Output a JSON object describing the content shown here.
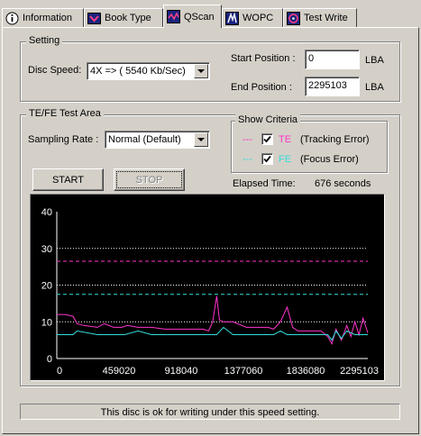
{
  "tabs": [
    {
      "label": "Information",
      "icon": "info-icon"
    },
    {
      "label": "Book Type",
      "icon": "book-type-icon"
    },
    {
      "label": "QScan",
      "icon": "qscan-icon"
    },
    {
      "label": "WOPC",
      "icon": "wopc-icon"
    },
    {
      "label": "Test Write",
      "icon": "test-write-icon"
    }
  ],
  "active_tab": "QScan",
  "setting": {
    "title": "Setting",
    "disc_speed_label": "Disc Speed:",
    "disc_speed_value": "4X => ( 5540 Kb/Sec)",
    "start_position_label": "Start Position :",
    "start_position_value": "0",
    "end_position_label": "End Position :",
    "end_position_value": "2295103",
    "unit_lba": "LBA"
  },
  "test_area": {
    "title": "TE/FE Test Area",
    "sampling_rate_label": "Sampling Rate :",
    "sampling_rate_value": "Normal (Default)",
    "start_button": "START",
    "stop_button": "STOP",
    "elapsed_label": "Elapsed Time:",
    "elapsed_value": "676 seconds"
  },
  "show_criteria": {
    "title": "Show Criteria",
    "te_dash": "---",
    "te_code": "TE",
    "te_desc": "(Tracking Error)",
    "fe_dash": "---",
    "fe_code": "FE",
    "fe_desc": "(Focus Error)",
    "te_checked": true,
    "fe_checked": true
  },
  "colors": {
    "te": "#ff33cc",
    "fe": "#33dddd",
    "chart_bg": "#000000",
    "grid": "#ffffff"
  },
  "chart_data": {
    "type": "line",
    "xlim": [
      0,
      2295103
    ],
    "ylim": [
      0,
      40
    ],
    "x_ticks": [
      "0",
      "459020",
      "918040",
      "1377060",
      "1836080",
      "2295103"
    ],
    "y_ticks": [
      "0",
      "10",
      "20",
      "30",
      "40"
    ],
    "grid": "dotted horizontal at 10, 20, 30",
    "thresholds": [
      {
        "series": "TE",
        "value": 26.5
      },
      {
        "series": "FE",
        "value": 17.5
      }
    ],
    "series": [
      {
        "name": "TE",
        "x": [
          0,
          60000,
          120000,
          150000,
          200000,
          300000,
          350000,
          420000,
          480000,
          520000,
          600000,
          700000,
          800000,
          900000,
          1000000,
          1080000,
          1120000,
          1150000,
          1180000,
          1200000,
          1230000,
          1260000,
          1300000,
          1400000,
          1500000,
          1560000,
          1600000,
          1650000,
          1700000,
          1740000,
          1780000,
          1800000,
          1850000,
          1900000,
          1950000,
          2000000,
          2030000,
          2060000,
          2100000,
          2140000,
          2170000,
          2200000,
          2230000,
          2260000,
          2295103
        ],
        "y": [
          12,
          12,
          11.5,
          9.5,
          9,
          8.5,
          9.5,
          8.5,
          8.5,
          9,
          8.5,
          8.5,
          8,
          8,
          8,
          8,
          7.5,
          10,
          17,
          10.5,
          10,
          10,
          10,
          8.5,
          8.5,
          8.5,
          8,
          10,
          14,
          8.5,
          7.5,
          7.5,
          7.5,
          7.5,
          7.5,
          6,
          4,
          8,
          5,
          9,
          6,
          10,
          6.5,
          11,
          7
        ]
      },
      {
        "name": "FE",
        "x": [
          0,
          120000,
          150000,
          300000,
          500000,
          600000,
          700000,
          900000,
          1000000,
          1100000,
          1150000,
          1180000,
          1230000,
          1300000,
          1500000,
          1600000,
          1650000,
          1700000,
          1900000,
          2000000,
          2030000,
          2060000,
          2100000,
          2140000,
          2200000,
          2295103
        ],
        "y": [
          6.5,
          6.5,
          7.5,
          6.5,
          6.5,
          7.5,
          6.5,
          6.5,
          6.5,
          6.5,
          6.5,
          6.5,
          8.5,
          6.5,
          6.5,
          6.5,
          7.5,
          6.5,
          6.5,
          6.5,
          5,
          7.5,
          5.5,
          7.5,
          6.5,
          6.5
        ]
      }
    ]
  },
  "status_text": "This disc is ok for writing under this speed setting."
}
